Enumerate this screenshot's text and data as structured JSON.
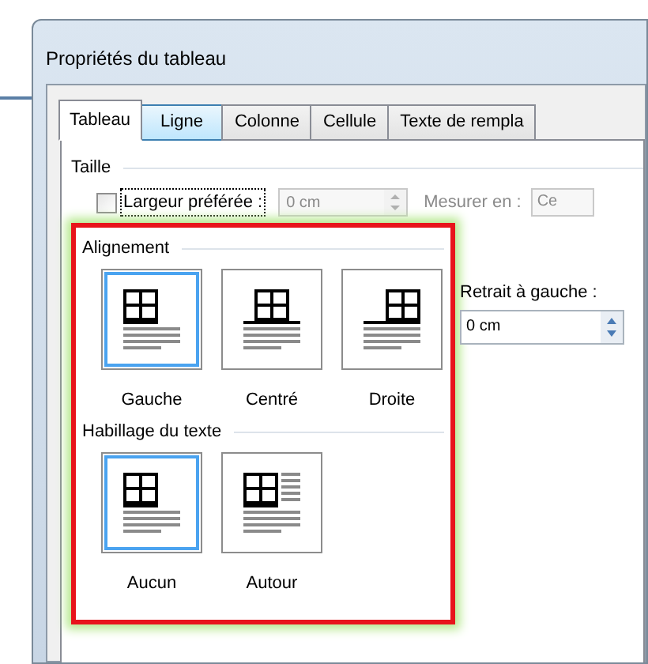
{
  "window": {
    "title": "Propriétés du tableau"
  },
  "tabs": [
    {
      "label": "Tableau",
      "selected": true,
      "hovered": false
    },
    {
      "label": "Ligne",
      "selected": false,
      "hovered": true
    },
    {
      "label": "Colonne",
      "selected": false,
      "hovered": false
    },
    {
      "label": "Cellule",
      "selected": false,
      "hovered": false
    },
    {
      "label": "Texte de rempla",
      "selected": false,
      "hovered": false
    }
  ],
  "size": {
    "heading": "Taille",
    "preferred_width": {
      "label": "Largeur préférée :",
      "checked": false,
      "focused": true
    },
    "width_field": {
      "value": "0 cm",
      "disabled": true
    },
    "measure": {
      "label": "Mesurer en :",
      "disabled": true
    },
    "measure_field": {
      "value": "Ce",
      "disabled": true
    }
  },
  "alignment": {
    "heading": "Alignement",
    "options": [
      {
        "label": "Gauche",
        "kind": "left",
        "selected": true
      },
      {
        "label": "Centré",
        "kind": "center",
        "selected": false
      },
      {
        "label": "Droite",
        "kind": "right",
        "selected": false
      }
    ]
  },
  "indent": {
    "label": "Retrait à gauche :",
    "value": "0 cm"
  },
  "wrapping": {
    "heading": "Habillage du texte",
    "options": [
      {
        "label": "Aucun",
        "kind": "none",
        "selected": true
      },
      {
        "label": "Autour",
        "kind": "around",
        "selected": false
      }
    ]
  }
}
